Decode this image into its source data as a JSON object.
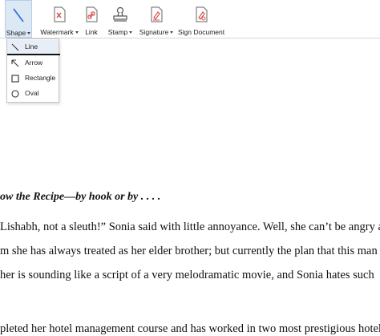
{
  "toolbar": {
    "shape": "Shape",
    "watermark": "Watermark",
    "link": "Link",
    "stamp": "Stamp",
    "signature": "Signature",
    "sign_document": "Sign Document"
  },
  "shape_menu": {
    "items": [
      {
        "label": "Line",
        "icon": "line-icon"
      },
      {
        "label": "Arrow",
        "icon": "arrow-icon"
      },
      {
        "label": "Rectangle",
        "icon": "rectangle-icon"
      },
      {
        "label": "Oval",
        "icon": "oval-icon"
      }
    ]
  },
  "document": {
    "heading": "ow the Recipe—by hook or by . . . .",
    "lines": [
      "Lishabh, not a sleuth!” Sonia said with little annoyance. Well, she can’t be angry at",
      "m she has always treated as her elder brother; but currently the plan that this man",
      " her is sounding like a script of a very melodramatic movie, and Sonia hates such",
      "pleted her hotel management course and has worked in two most prestigious hotel"
    ]
  },
  "colors": {
    "accent": "#2e74d4",
    "icon_red": "#d9534f",
    "active_bg": "#dde8f5"
  }
}
